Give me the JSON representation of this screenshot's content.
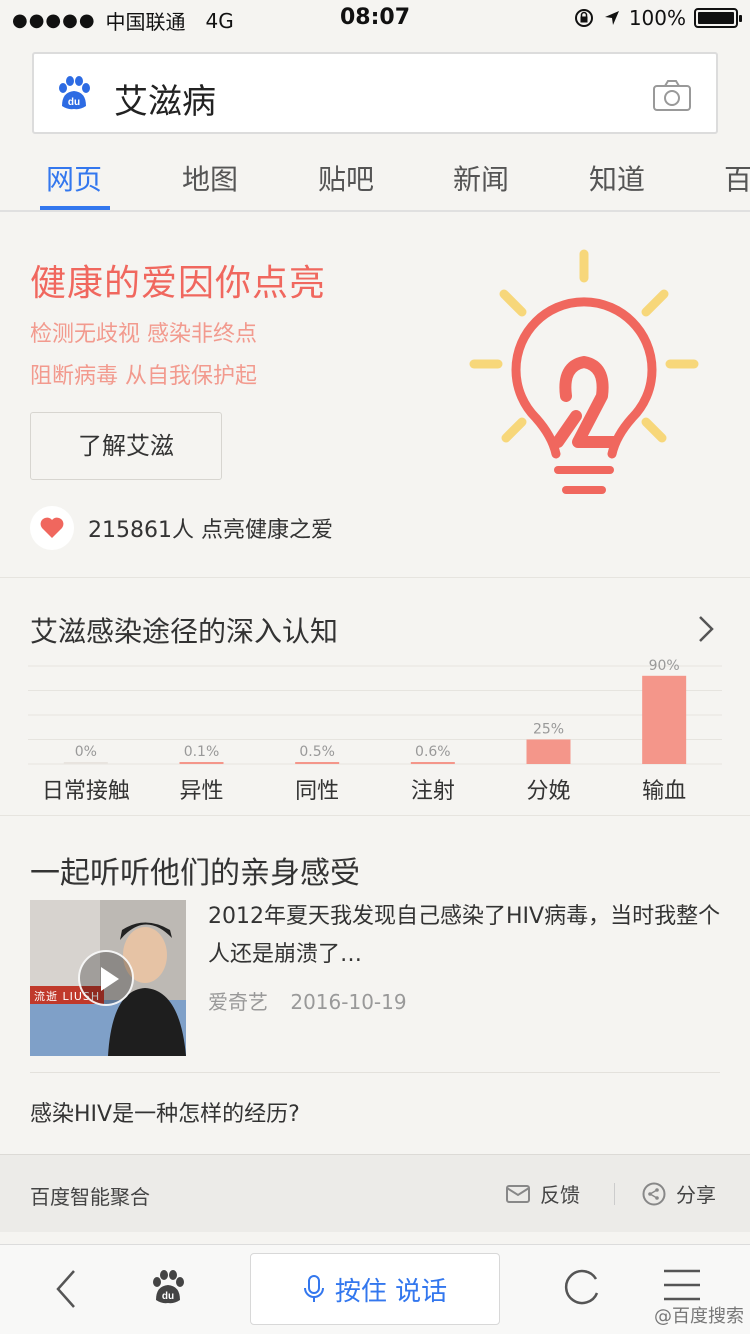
{
  "status_bar": {
    "signal": "●●●●●",
    "carrier": "中国联通",
    "network": "4G",
    "time": "08:07",
    "battery": "100%"
  },
  "search": {
    "logo_text": "du",
    "query": "艾滋病"
  },
  "tabs": [
    {
      "label": "网页",
      "active": true
    },
    {
      "label": "地图",
      "active": false
    },
    {
      "label": "贴吧",
      "active": false
    },
    {
      "label": "新闻",
      "active": false
    },
    {
      "label": "知道",
      "active": false
    },
    {
      "label": "百",
      "active": false
    }
  ],
  "hero": {
    "title": "健康的爱因你点亮",
    "subtitle_1": "检测无歧视 感染非终点",
    "subtitle_2": "阻断病毒 从自我保护起",
    "button": "了解艾滋",
    "like_text": "215861人 点亮健康之爱"
  },
  "chart_section": {
    "title": "艾滋感染途径的深入认知"
  },
  "chart_data": {
    "type": "bar",
    "categories": [
      "日常接触",
      "异性",
      "同性",
      "注射",
      "分娩",
      "输血"
    ],
    "value_labels": [
      "0%",
      "0.1%",
      "0.5%",
      "0.6%",
      "25%",
      "90%"
    ],
    "values": [
      0,
      0.1,
      0.5,
      0.6,
      25,
      90
    ],
    "ylim": [
      0,
      100
    ],
    "grid": true,
    "bar_color": "#f4968a"
  },
  "video_section": {
    "title": "一起听听他们的亲身感受",
    "thumb_banner": "流逝 LIUSH",
    "text": "2012年夏天我发现自己感染了HIV病毒，当时我整个人还是崩溃了…",
    "source": "爱奇艺",
    "date": "2016-10-19",
    "question": "感染HIV是一种怎样的经历?"
  },
  "footer": {
    "source": "百度智能聚合",
    "feedback": "反馈",
    "share": "分享"
  },
  "toolbar": {
    "talk": "按住 说话"
  },
  "watermark": "@百度搜索",
  "colors": {
    "accent": "#3377ee",
    "hero_red": "#f0675e",
    "bulb_yellow": "#f7d77a"
  }
}
